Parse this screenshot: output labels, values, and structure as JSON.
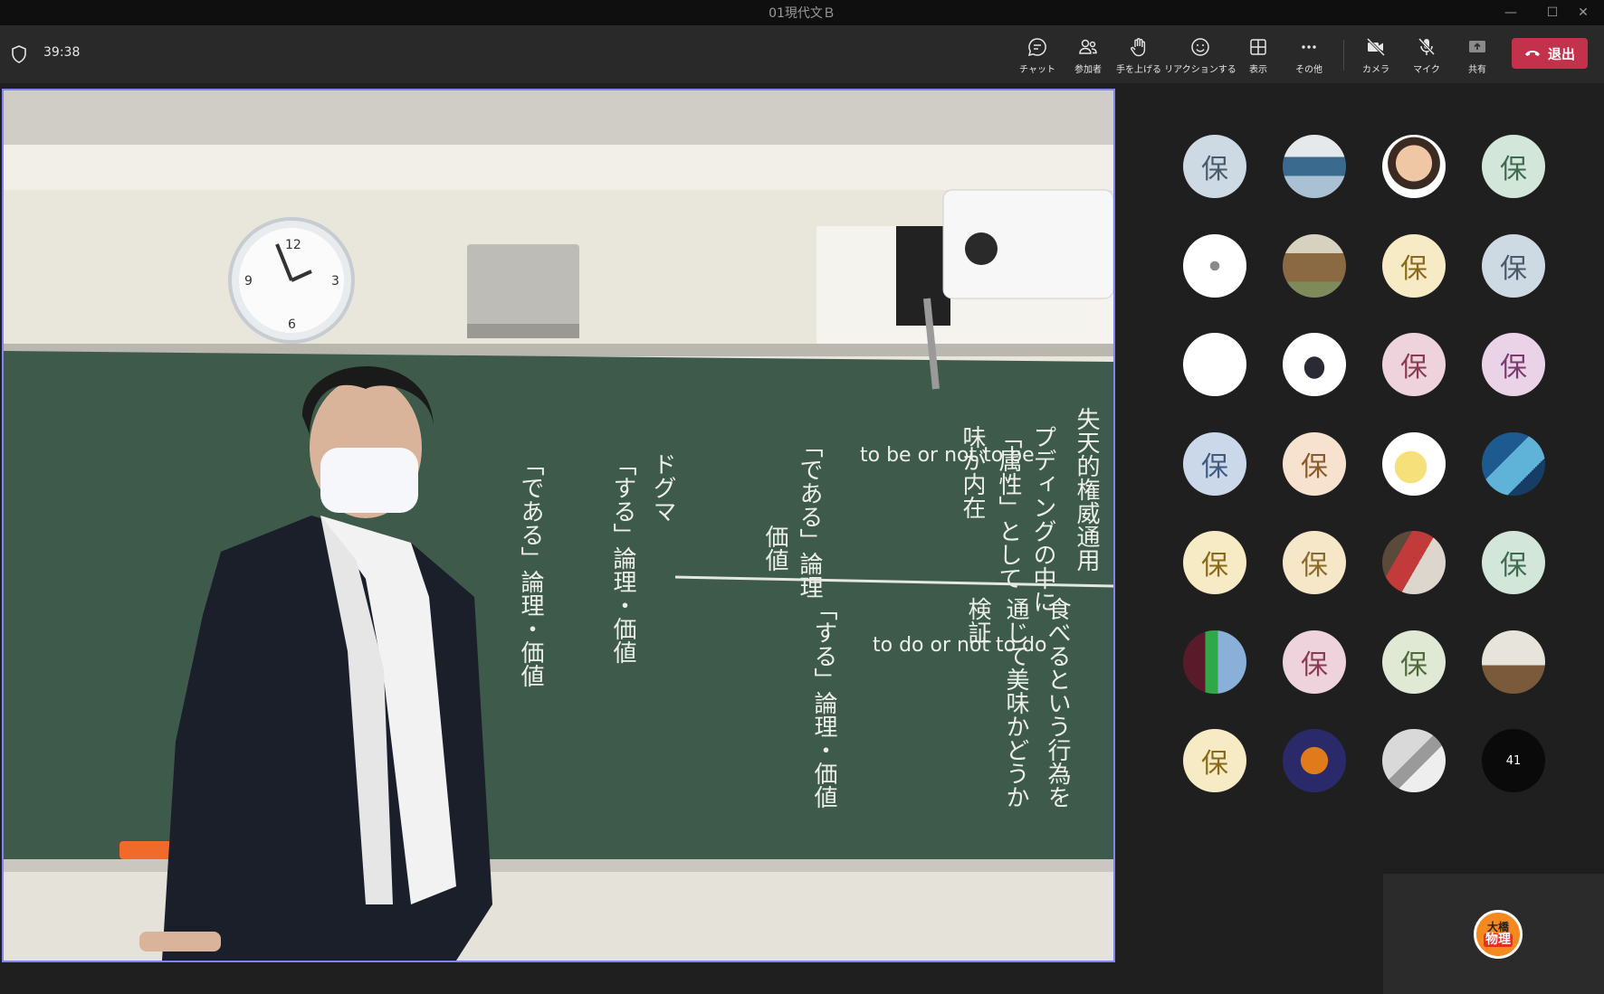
{
  "window": {
    "title": "01現代文Ｂ",
    "minimize_icon": "minimize-icon",
    "maximize_icon": "maximize-icon",
    "close_icon": "close-icon"
  },
  "toolbar": {
    "timer": "39:38",
    "buttons": [
      {
        "label": "チャット",
        "icon": "chat-icon"
      },
      {
        "label": "参加者",
        "icon": "people-icon"
      },
      {
        "label": "手を上げる",
        "icon": "raise-hand-icon"
      },
      {
        "label": "リアクションする",
        "icon": "reaction-icon"
      },
      {
        "label": "表示",
        "icon": "view-icon"
      },
      {
        "label": "その他",
        "icon": "more-icon"
      },
      {
        "label": "カメラ",
        "icon": "camera-off-icon"
      },
      {
        "label": "マイク",
        "icon": "mic-off-icon"
      },
      {
        "label": "共有",
        "icon": "share-icon"
      }
    ],
    "leave_label": "退出",
    "leave_color": "#c4314b"
  },
  "video": {
    "chalkboard": {
      "col1": "「である」論理・価値",
      "col2": "「する」論理・価値",
      "col3": "ドグマ",
      "col4": "「である」論理",
      "col5": "価値",
      "col6": "to be or not to be",
      "col7": "味が内在",
      "col8": "「属性」として",
      "col9": "プディングの中に",
      "col10": "失天的権威通用",
      "col11": "「する」論理・価値",
      "col12": "to do or not to do",
      "col13": "検証",
      "col14": "通じて美味かどうか",
      "col15": "食べるという行為を"
    }
  },
  "gallery": {
    "initial": "保",
    "overflow_count": "41",
    "participants": [
      {
        "kind": "initial",
        "bg": "#cdd9e3",
        "fg": "#4a5a6a"
      },
      {
        "kind": "photo",
        "icon": "ship-photo-avatar"
      },
      {
        "kind": "photo",
        "icon": "memoji-boy-avatar"
      },
      {
        "kind": "initial",
        "bg": "#d3e6da",
        "fg": "#3f6a4f"
      },
      {
        "kind": "photo",
        "icon": "sketch-animal-avatar"
      },
      {
        "kind": "photo",
        "icon": "pagoda-photo-avatar"
      },
      {
        "kind": "initial",
        "bg": "#f6ebc4",
        "fg": "#8a6a1a"
      },
      {
        "kind": "initial",
        "bg": "#cdd9e3",
        "fg": "#4a5a6a"
      },
      {
        "kind": "blank",
        "icon": "blank-white-avatar"
      },
      {
        "kind": "photo",
        "icon": "anime-girl-avatar"
      },
      {
        "kind": "initial",
        "bg": "#efd3dc",
        "fg": "#8a3a52"
      },
      {
        "kind": "initial",
        "bg": "#ead3e6",
        "fg": "#7a3a70"
      },
      {
        "kind": "initial",
        "bg": "#cbd8ea",
        "fg": "#3f5a80"
      },
      {
        "kind": "initial",
        "bg": "#f6e2cf",
        "fg": "#8a5a2a"
      },
      {
        "kind": "photo",
        "icon": "cartoon-bean-avatar"
      },
      {
        "kind": "photo",
        "icon": "wave-art-avatar"
      },
      {
        "kind": "initial",
        "bg": "#f6ebc4",
        "fg": "#8a6a1a"
      },
      {
        "kind": "initial",
        "bg": "#f6e7c8",
        "fg": "#8a6a2a"
      },
      {
        "kind": "photo",
        "icon": "figures-photo-avatar"
      },
      {
        "kind": "initial",
        "bg": "#d3e6da",
        "fg": "#3f6a4f"
      },
      {
        "kind": "photo",
        "icon": "drinks-photo-avatar"
      },
      {
        "kind": "initial",
        "bg": "#efd3dc",
        "fg": "#8a3a52"
      },
      {
        "kind": "initial",
        "bg": "#dfe9d3",
        "fg": "#4f6a3a"
      },
      {
        "kind": "photo",
        "icon": "bird-photo-avatar"
      },
      {
        "kind": "initial",
        "bg": "#f6ebc4",
        "fg": "#8a6a1a"
      },
      {
        "kind": "photo",
        "icon": "fire-art-avatar"
      },
      {
        "kind": "photo",
        "icon": "anime-sketch-avatar"
      },
      {
        "kind": "overflow"
      }
    ]
  },
  "self_view": {
    "badge_line1": "大橋",
    "badge_line2": "物理",
    "badge_color": "#f48a1f"
  }
}
